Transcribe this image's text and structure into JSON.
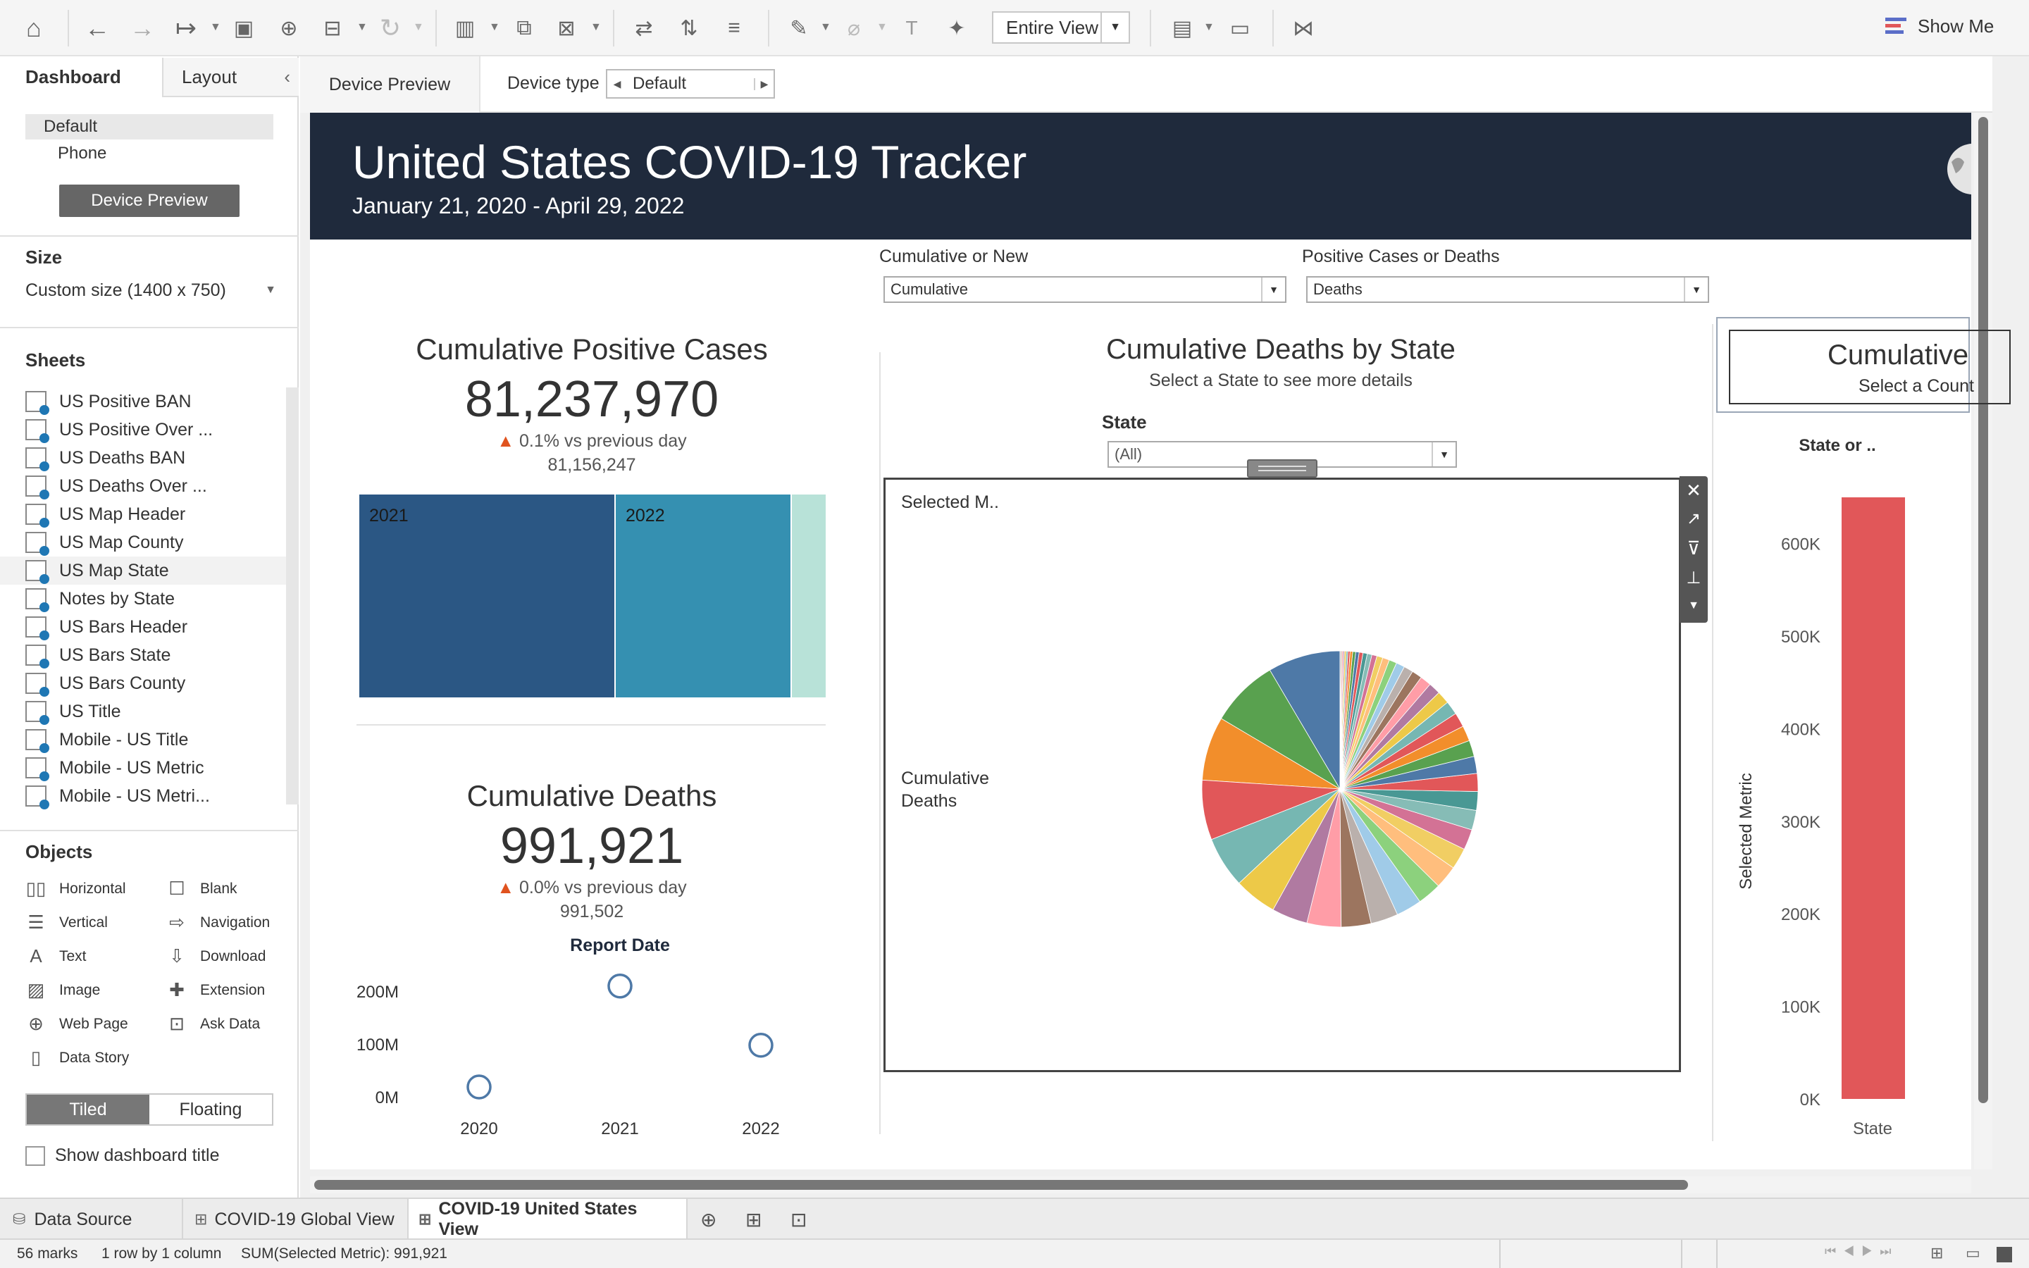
{
  "toolbar": {
    "view_mode": "Entire View",
    "show_me": "Show Me",
    "icons": [
      "home-icon",
      "undo-icon",
      "redo-icon",
      "forward-icon",
      "save-icon",
      "new-datasource-icon",
      "pause-icon",
      "refresh-icon",
      "new-worksheet-icon",
      "duplicate-icon",
      "clear-icon",
      "swap-icon",
      "sort-asc-icon",
      "sort-desc-icon",
      "highlight-icon",
      "group-icon",
      "label-icon",
      "pin-icon",
      "fit-icon",
      "presentation-icon",
      "share-icon"
    ]
  },
  "left_panel": {
    "tabs": {
      "dashboard": "Dashboard",
      "layout": "Layout"
    },
    "devices": [
      "Default",
      "Phone"
    ],
    "device_preview": "Device Preview",
    "size_title": "Size",
    "size_value": "Custom size (1400 x 750)",
    "sheets_title": "Sheets",
    "sheets": [
      "US Positive BAN",
      "US Positive Over ...",
      "US Deaths BAN",
      "US Deaths Over ...",
      "US Map Header",
      "US Map County",
      "US Map State",
      "Notes by State",
      "US Bars Header",
      "US Bars State",
      "US Bars County",
      "US Title",
      "Mobile - US Title",
      "Mobile - US Metric",
      "Mobile - US Metri..."
    ],
    "objects_title": "Objects",
    "objects": [
      {
        "label": "Horizontal",
        "icon": "horizontal-icon"
      },
      {
        "label": "Blank",
        "icon": "blank-icon"
      },
      {
        "label": "Vertical",
        "icon": "vertical-icon"
      },
      {
        "label": "Navigation",
        "icon": "navigation-icon"
      },
      {
        "label": "Text",
        "icon": "text-icon"
      },
      {
        "label": "Download",
        "icon": "download-icon"
      },
      {
        "label": "Image",
        "icon": "image-icon"
      },
      {
        "label": "Extension",
        "icon": "extension-icon"
      },
      {
        "label": "Web Page",
        "icon": "web-page-icon"
      },
      {
        "label": "Ask Data",
        "icon": "ask-data-icon"
      },
      {
        "label": "Data Story",
        "icon": "data-story-icon"
      }
    ],
    "tiled": "Tiled",
    "floating": "Floating",
    "show_title": "Show dashboard title"
  },
  "device_bar": {
    "preview": "Device Preview",
    "type_label": "Device type",
    "type_value": "Default"
  },
  "dashboard": {
    "title": "United States COVID-19 Tracker",
    "subtitle": "January 21, 2020 - April 29, 2022",
    "filters": {
      "cum_label": "Cumulative or New",
      "cum_value": "Cumulative",
      "metric_label": "Positive Cases or Deaths",
      "metric_value": "Deaths"
    },
    "positive": {
      "title": "Cumulative Positive Cases",
      "value": "81,237,970",
      "delta": "0.1% vs previous day",
      "prev": "81,156,247",
      "treemap": [
        {
          "label": "2021",
          "color": "#2b5784"
        },
        {
          "label": "2022",
          "color": "#3590b1"
        },
        {
          "label": "",
          "color": "#b8e2d8"
        }
      ]
    },
    "deaths": {
      "title": "Cumulative Deaths",
      "value": "991,921",
      "delta": "0.0% vs previous day",
      "prev": "991,502"
    },
    "state_panel": {
      "title": "Cumulative Deaths by State",
      "subtitle": "Select a State to see more details",
      "state_label": "State",
      "state_value": "(All)",
      "selected_label": "Selected M..",
      "row_label": "Cumulative Deaths"
    },
    "right_panel": {
      "title": "Cumulative",
      "subtitle": "Select a Count",
      "col_label": "State or ..",
      "yaxis_label": "Selected Metric",
      "xaxis_label": "State"
    },
    "arrow_color": "#e0531f"
  },
  "charts": {
    "scatter": {
      "type": "scatter",
      "title": "Report Date",
      "x": [
        "2020",
        "2021",
        "2022"
      ],
      "y": [
        20000000,
        211000000,
        99000000
      ],
      "yticks": [
        "200M",
        "100M",
        "0M"
      ],
      "ytick_values": [
        200000000,
        100000000,
        0
      ],
      "ylim": [
        0,
        200000000
      ],
      "color": "#4e79a7"
    },
    "pie": {
      "type": "pie",
      "values": [
        8.5,
        8.0,
        7.5,
        7.0,
        6.0,
        5.0,
        4.2,
        4.0,
        3.5,
        3.2,
        3.0,
        2.8,
        2.7,
        2.5,
        2.4,
        2.3,
        2.2,
        2.1,
        2.0,
        1.9,
        1.8,
        1.7,
        1.6,
        1.5,
        1.4,
        1.3,
        1.2,
        1.1,
        1.0,
        0.9,
        0.8,
        0.7,
        0.6,
        0.55,
        0.5,
        0.45,
        0.4,
        0.35,
        0.3,
        0.25,
        0.2,
        0.2,
        0.15,
        0.15,
        0.12,
        0.1
      ],
      "colors": [
        "#4e79a7",
        "#59a14f",
        "#f28e2b",
        "#e15759",
        "#76b7b2",
        "#edc948",
        "#b07aa1",
        "#ff9da7",
        "#9c755f",
        "#bab0ac",
        "#a0cbe8",
        "#8cd17d",
        "#ffbe7d",
        "#f1ce63",
        "#d37295",
        "#86bcb6",
        "#499894",
        "#e15759"
      ]
    },
    "bar": {
      "type": "bar",
      "categories": [
        "State"
      ],
      "values": [
        650000
      ],
      "ylim": [
        0,
        650000
      ],
      "yticks": [
        "600K",
        "500K",
        "400K",
        "300K",
        "200K",
        "100K",
        "0K"
      ],
      "ytick_values": [
        600000,
        500000,
        400000,
        300000,
        200000,
        100000,
        0
      ],
      "color": "#e15759"
    }
  },
  "tabs": {
    "items": [
      "Data Source",
      "COVID-19 Global View",
      "COVID-19 United States View"
    ],
    "active": "COVID-19 United States View"
  },
  "status": {
    "marks": "56 marks",
    "rows": "1 row by 1 column",
    "sum": "SUM(Selected Metric): 991,921"
  }
}
